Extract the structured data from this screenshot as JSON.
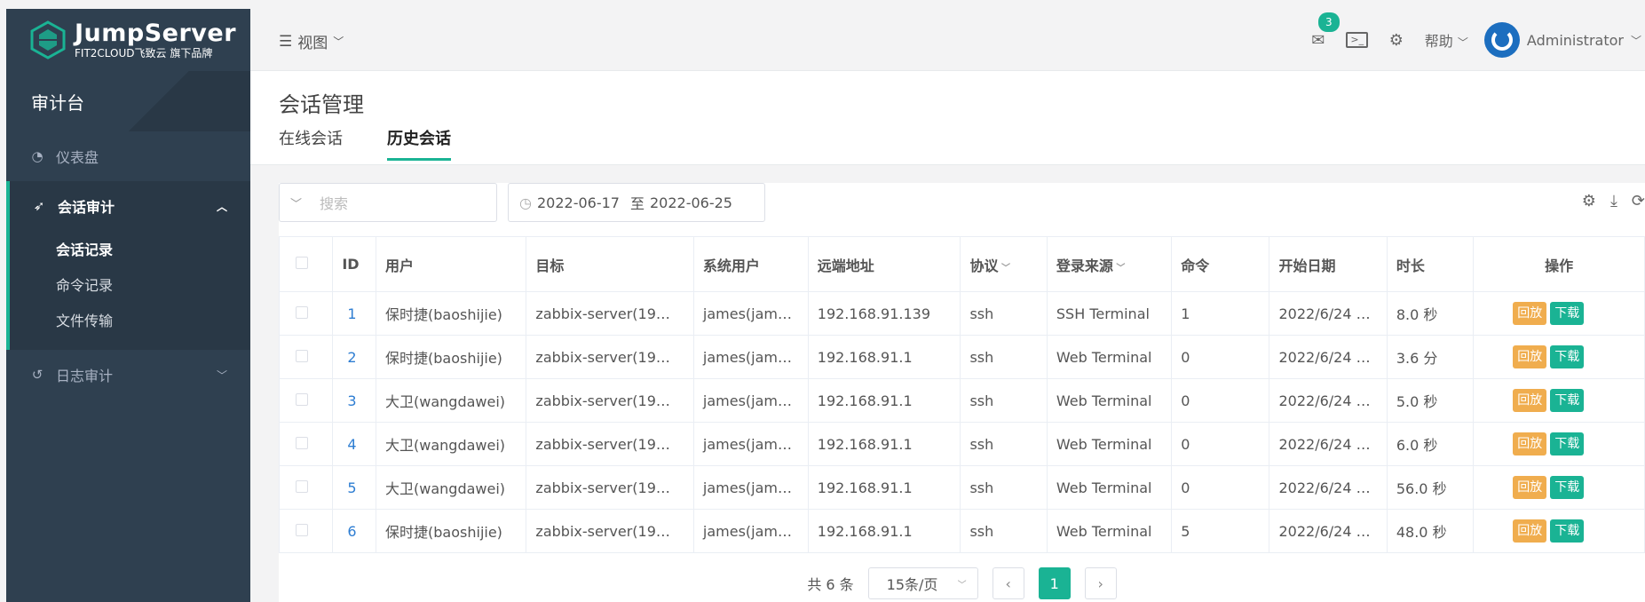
{
  "brand": {
    "name": "JumpServer",
    "sub": "FIT2CLOUD飞致云 旗下品牌"
  },
  "sidebar": {
    "console_title": "审计台",
    "items": [
      {
        "label": "仪表盘",
        "icon": "dashboard-icon"
      },
      {
        "label": "会话审计",
        "icon": "rocket-icon",
        "expanded": true,
        "children": [
          "会话记录",
          "命令记录",
          "文件传输"
        ],
        "active_child": "会话记录"
      },
      {
        "label": "日志审计",
        "icon": "history-icon"
      }
    ]
  },
  "header": {
    "view_label": "视图",
    "notification_count": "3",
    "help_label": "帮助",
    "user_name": "Administrator"
  },
  "page": {
    "title": "会话管理",
    "tabs": [
      "在线会话",
      "历史会话"
    ],
    "active_tab": "历史会话"
  },
  "filters": {
    "search_placeholder": "搜索",
    "date_from": "2022-06-17",
    "date_sep": "至",
    "date_to": "2022-06-25"
  },
  "table": {
    "columns": [
      "ID",
      "用户",
      "目标",
      "系统用户",
      "远端地址",
      "协议",
      "登录来源",
      "命令",
      "开始日期",
      "时长",
      "操作"
    ],
    "rows": [
      {
        "id": "1",
        "user": "保时捷(baoshijie)",
        "target": "zabbix-server(19…",
        "sysuser": "james(jam…",
        "remote": "192.168.91.139",
        "protocol": "ssh",
        "source": "SSH Terminal",
        "commands": "1",
        "start": "2022/6/24 …",
        "duration": "8.0 秒"
      },
      {
        "id": "2",
        "user": "保时捷(baoshijie)",
        "target": "zabbix-server(19…",
        "sysuser": "james(jam…",
        "remote": "192.168.91.1",
        "protocol": "ssh",
        "source": "Web Terminal",
        "commands": "0",
        "start": "2022/6/24 …",
        "duration": "3.6 分"
      },
      {
        "id": "3",
        "user": "大卫(wangdawei)",
        "target": "zabbix-server(19…",
        "sysuser": "james(jam…",
        "remote": "192.168.91.1",
        "protocol": "ssh",
        "source": "Web Terminal",
        "commands": "0",
        "start": "2022/6/24 …",
        "duration": "5.0 秒"
      },
      {
        "id": "4",
        "user": "大卫(wangdawei)",
        "target": "zabbix-server(19…",
        "sysuser": "james(jam…",
        "remote": "192.168.91.1",
        "protocol": "ssh",
        "source": "Web Terminal",
        "commands": "0",
        "start": "2022/6/24 …",
        "duration": "6.0 秒"
      },
      {
        "id": "5",
        "user": "大卫(wangdawei)",
        "target": "zabbix-server(19…",
        "sysuser": "james(jam…",
        "remote": "192.168.91.1",
        "protocol": "ssh",
        "source": "Web Terminal",
        "commands": "0",
        "start": "2022/6/24 …",
        "duration": "56.0 秒"
      },
      {
        "id": "6",
        "user": "保时捷(baoshijie)",
        "target": "zabbix-server(19…",
        "sysuser": "james(jam…",
        "remote": "192.168.91.1",
        "protocol": "ssh",
        "source": "Web Terminal",
        "commands": "5",
        "start": "2022/6/24 …",
        "duration": "48.0 秒"
      }
    ],
    "actions": {
      "replay": "回放",
      "download": "下载"
    }
  },
  "pagination": {
    "total": "共 6 条",
    "page_size": "15条/页",
    "current_page": "1"
  },
  "colors": {
    "accent": "#1ab394",
    "sidebar_bg": "#2f4050",
    "replay": "#f0ad4e",
    "link": "#2d7dd2"
  }
}
